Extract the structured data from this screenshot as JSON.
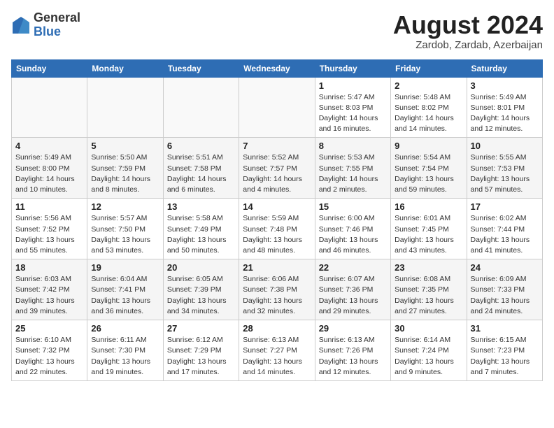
{
  "header": {
    "logo_line1": "General",
    "logo_line2": "Blue",
    "title": "August 2024",
    "subtitle": "Zardob, Zardab, Azerbaijan"
  },
  "days_of_week": [
    "Sunday",
    "Monday",
    "Tuesday",
    "Wednesday",
    "Thursday",
    "Friday",
    "Saturday"
  ],
  "weeks": [
    [
      {
        "day": "",
        "info": ""
      },
      {
        "day": "",
        "info": ""
      },
      {
        "day": "",
        "info": ""
      },
      {
        "day": "",
        "info": ""
      },
      {
        "day": "1",
        "info": "Sunrise: 5:47 AM\nSunset: 8:03 PM\nDaylight: 14 hours\nand 16 minutes."
      },
      {
        "day": "2",
        "info": "Sunrise: 5:48 AM\nSunset: 8:02 PM\nDaylight: 14 hours\nand 14 minutes."
      },
      {
        "day": "3",
        "info": "Sunrise: 5:49 AM\nSunset: 8:01 PM\nDaylight: 14 hours\nand 12 minutes."
      }
    ],
    [
      {
        "day": "4",
        "info": "Sunrise: 5:49 AM\nSunset: 8:00 PM\nDaylight: 14 hours\nand 10 minutes."
      },
      {
        "day": "5",
        "info": "Sunrise: 5:50 AM\nSunset: 7:59 PM\nDaylight: 14 hours\nand 8 minutes."
      },
      {
        "day": "6",
        "info": "Sunrise: 5:51 AM\nSunset: 7:58 PM\nDaylight: 14 hours\nand 6 minutes."
      },
      {
        "day": "7",
        "info": "Sunrise: 5:52 AM\nSunset: 7:57 PM\nDaylight: 14 hours\nand 4 minutes."
      },
      {
        "day": "8",
        "info": "Sunrise: 5:53 AM\nSunset: 7:55 PM\nDaylight: 14 hours\nand 2 minutes."
      },
      {
        "day": "9",
        "info": "Sunrise: 5:54 AM\nSunset: 7:54 PM\nDaylight: 13 hours\nand 59 minutes."
      },
      {
        "day": "10",
        "info": "Sunrise: 5:55 AM\nSunset: 7:53 PM\nDaylight: 13 hours\nand 57 minutes."
      }
    ],
    [
      {
        "day": "11",
        "info": "Sunrise: 5:56 AM\nSunset: 7:52 PM\nDaylight: 13 hours\nand 55 minutes."
      },
      {
        "day": "12",
        "info": "Sunrise: 5:57 AM\nSunset: 7:50 PM\nDaylight: 13 hours\nand 53 minutes."
      },
      {
        "day": "13",
        "info": "Sunrise: 5:58 AM\nSunset: 7:49 PM\nDaylight: 13 hours\nand 50 minutes."
      },
      {
        "day": "14",
        "info": "Sunrise: 5:59 AM\nSunset: 7:48 PM\nDaylight: 13 hours\nand 48 minutes."
      },
      {
        "day": "15",
        "info": "Sunrise: 6:00 AM\nSunset: 7:46 PM\nDaylight: 13 hours\nand 46 minutes."
      },
      {
        "day": "16",
        "info": "Sunrise: 6:01 AM\nSunset: 7:45 PM\nDaylight: 13 hours\nand 43 minutes."
      },
      {
        "day": "17",
        "info": "Sunrise: 6:02 AM\nSunset: 7:44 PM\nDaylight: 13 hours\nand 41 minutes."
      }
    ],
    [
      {
        "day": "18",
        "info": "Sunrise: 6:03 AM\nSunset: 7:42 PM\nDaylight: 13 hours\nand 39 minutes."
      },
      {
        "day": "19",
        "info": "Sunrise: 6:04 AM\nSunset: 7:41 PM\nDaylight: 13 hours\nand 36 minutes."
      },
      {
        "day": "20",
        "info": "Sunrise: 6:05 AM\nSunset: 7:39 PM\nDaylight: 13 hours\nand 34 minutes."
      },
      {
        "day": "21",
        "info": "Sunrise: 6:06 AM\nSunset: 7:38 PM\nDaylight: 13 hours\nand 32 minutes."
      },
      {
        "day": "22",
        "info": "Sunrise: 6:07 AM\nSunset: 7:36 PM\nDaylight: 13 hours\nand 29 minutes."
      },
      {
        "day": "23",
        "info": "Sunrise: 6:08 AM\nSunset: 7:35 PM\nDaylight: 13 hours\nand 27 minutes."
      },
      {
        "day": "24",
        "info": "Sunrise: 6:09 AM\nSunset: 7:33 PM\nDaylight: 13 hours\nand 24 minutes."
      }
    ],
    [
      {
        "day": "25",
        "info": "Sunrise: 6:10 AM\nSunset: 7:32 PM\nDaylight: 13 hours\nand 22 minutes."
      },
      {
        "day": "26",
        "info": "Sunrise: 6:11 AM\nSunset: 7:30 PM\nDaylight: 13 hours\nand 19 minutes."
      },
      {
        "day": "27",
        "info": "Sunrise: 6:12 AM\nSunset: 7:29 PM\nDaylight: 13 hours\nand 17 minutes."
      },
      {
        "day": "28",
        "info": "Sunrise: 6:13 AM\nSunset: 7:27 PM\nDaylight: 13 hours\nand 14 minutes."
      },
      {
        "day": "29",
        "info": "Sunrise: 6:13 AM\nSunset: 7:26 PM\nDaylight: 13 hours\nand 12 minutes."
      },
      {
        "day": "30",
        "info": "Sunrise: 6:14 AM\nSunset: 7:24 PM\nDaylight: 13 hours\nand 9 minutes."
      },
      {
        "day": "31",
        "info": "Sunrise: 6:15 AM\nSunset: 7:23 PM\nDaylight: 13 hours\nand 7 minutes."
      }
    ]
  ]
}
